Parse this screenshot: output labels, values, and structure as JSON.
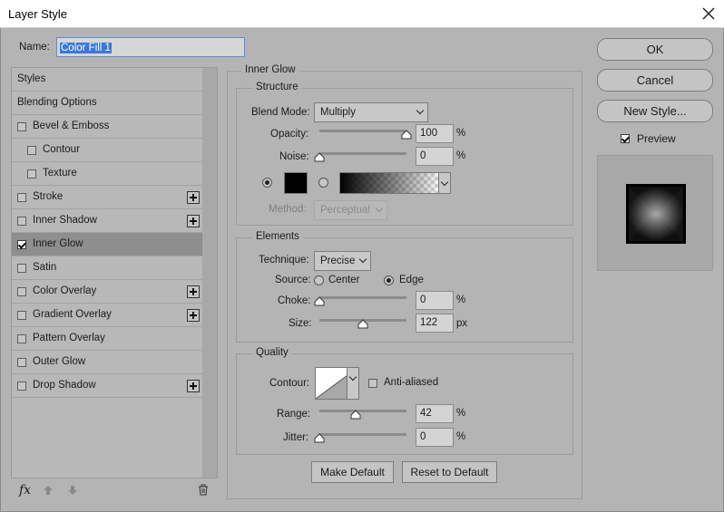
{
  "window": {
    "title": "Layer Style"
  },
  "name_field": {
    "label": "Name:",
    "value": "Color Fill 1"
  },
  "styles_list": {
    "items": [
      {
        "label": "Styles",
        "has_checkbox": false,
        "checked": false,
        "has_plus": false,
        "selected": false
      },
      {
        "label": "Blending Options",
        "has_checkbox": false,
        "checked": false,
        "has_plus": false,
        "selected": false
      },
      {
        "label": "Bevel & Emboss",
        "has_checkbox": true,
        "checked": false,
        "has_plus": false,
        "selected": false
      },
      {
        "label": "Contour",
        "has_checkbox": true,
        "checked": false,
        "has_plus": false,
        "selected": false,
        "indent": true
      },
      {
        "label": "Texture",
        "has_checkbox": true,
        "checked": false,
        "has_plus": false,
        "selected": false,
        "indent": true
      },
      {
        "label": "Stroke",
        "has_checkbox": true,
        "checked": false,
        "has_plus": true,
        "selected": false
      },
      {
        "label": "Inner Shadow",
        "has_checkbox": true,
        "checked": false,
        "has_plus": true,
        "selected": false
      },
      {
        "label": "Inner Glow",
        "has_checkbox": true,
        "checked": true,
        "has_plus": false,
        "selected": true
      },
      {
        "label": "Satin",
        "has_checkbox": true,
        "checked": false,
        "has_plus": false,
        "selected": false
      },
      {
        "label": "Color Overlay",
        "has_checkbox": true,
        "checked": false,
        "has_plus": true,
        "selected": false
      },
      {
        "label": "Gradient Overlay",
        "has_checkbox": true,
        "checked": false,
        "has_plus": true,
        "selected": false
      },
      {
        "label": "Pattern Overlay",
        "has_checkbox": true,
        "checked": false,
        "has_plus": false,
        "selected": false
      },
      {
        "label": "Outer Glow",
        "has_checkbox": true,
        "checked": false,
        "has_plus": false,
        "selected": false
      },
      {
        "label": "Drop Shadow",
        "has_checkbox": true,
        "checked": false,
        "has_plus": true,
        "selected": false
      }
    ],
    "fx_label": "fx"
  },
  "inner_glow": {
    "section_title": "Inner Glow",
    "structure": {
      "title": "Structure",
      "blend_mode_label": "Blend Mode:",
      "blend_mode_value": "Multiply",
      "opacity_label": "Opacity:",
      "opacity_value": "100",
      "opacity_unit": "%",
      "opacity_fraction": 1.0,
      "noise_label": "Noise:",
      "noise_value": "0",
      "noise_unit": "%",
      "noise_fraction": 0.0,
      "color_radio_selected": true,
      "gradient_radio_selected": false,
      "glow_color": "#000000",
      "method_label": "Method:",
      "method_value": "Perceptual"
    },
    "elements": {
      "title": "Elements",
      "technique_label": "Technique:",
      "technique_value": "Precise",
      "source_label": "Source:",
      "source_center_label": "Center",
      "source_edge_label": "Edge",
      "source_selected": "Edge",
      "choke_label": "Choke:",
      "choke_value": "0",
      "choke_unit": "%",
      "choke_fraction": 0.0,
      "size_label": "Size:",
      "size_value": "122",
      "size_unit": "px",
      "size_fraction": 0.5
    },
    "quality": {
      "title": "Quality",
      "contour_label": "Contour:",
      "anti_aliased_label": "Anti-aliased",
      "anti_aliased_checked": false,
      "range_label": "Range:",
      "range_value": "42",
      "range_unit": "%",
      "range_fraction": 0.42,
      "jitter_label": "Jitter:",
      "jitter_value": "0",
      "jitter_unit": "%",
      "jitter_fraction": 0.0
    },
    "make_default_label": "Make Default",
    "reset_default_label": "Reset to Default"
  },
  "actions": {
    "ok_label": "OK",
    "cancel_label": "Cancel",
    "new_style_label": "New Style...",
    "preview_label": "Preview",
    "preview_checked": true
  },
  "icons": [
    "close-icon",
    "fx-icon",
    "move-up-icon",
    "move-down-icon",
    "trash-icon",
    "chevron-down-icon",
    "plus-icon"
  ]
}
